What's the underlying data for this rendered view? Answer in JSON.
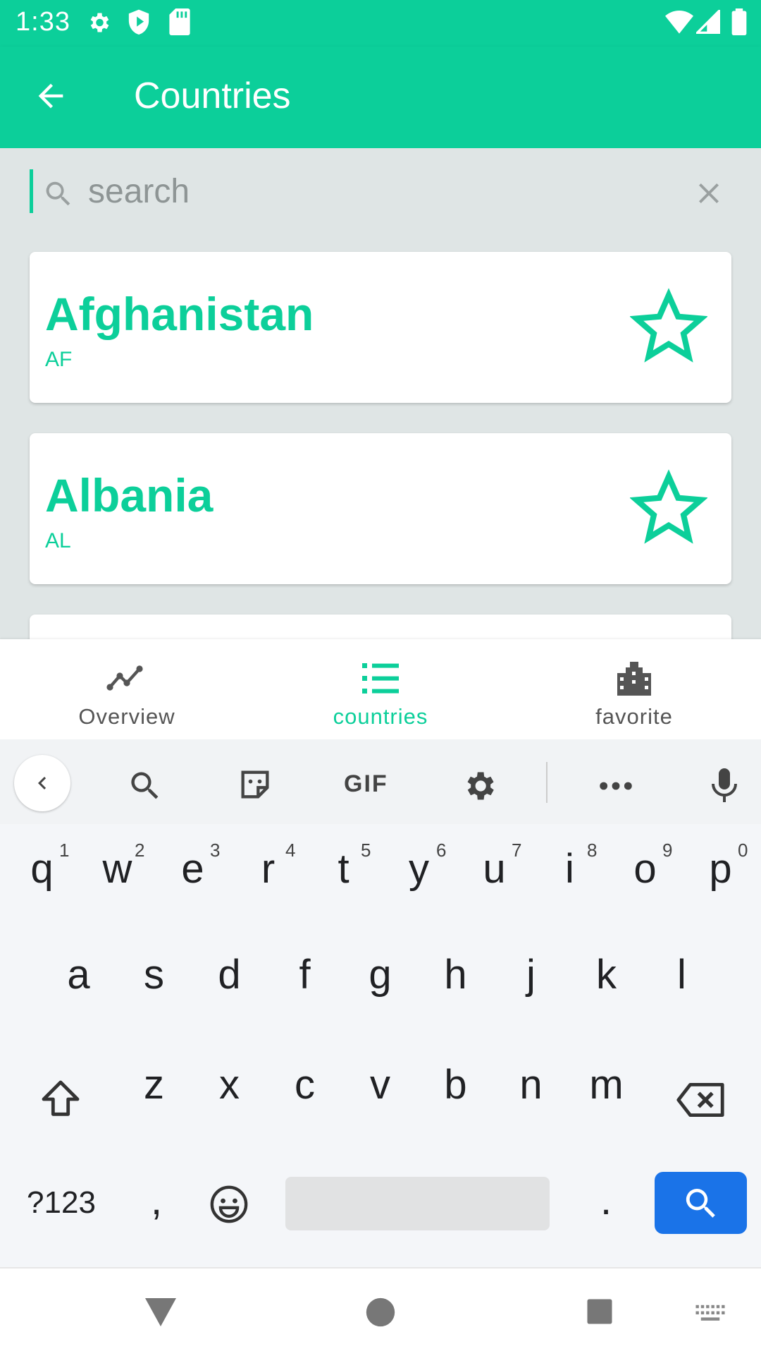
{
  "status_bar": {
    "time": "1:33"
  },
  "app_bar": {
    "title": "Countries"
  },
  "search": {
    "placeholder": "search",
    "value": ""
  },
  "countries": [
    {
      "name": "Afghanistan",
      "code": "AF",
      "favorite": false
    },
    {
      "name": "Albania",
      "code": "AL",
      "favorite": false
    }
  ],
  "bottom_nav": {
    "items": [
      {
        "label": "Overview",
        "active": false
      },
      {
        "label": "countries",
        "active": true
      },
      {
        "label": "favorite",
        "active": false
      }
    ]
  },
  "keyboard": {
    "toolbar": {
      "gif_label": "GIF"
    },
    "row1": [
      "q",
      "w",
      "e",
      "r",
      "t",
      "y",
      "u",
      "i",
      "o",
      "p"
    ],
    "row1_hints": [
      "1",
      "2",
      "3",
      "4",
      "5",
      "6",
      "7",
      "8",
      "9",
      "0"
    ],
    "row2": [
      "a",
      "s",
      "d",
      "f",
      "g",
      "h",
      "j",
      "k",
      "l"
    ],
    "row3": [
      "z",
      "x",
      "c",
      "v",
      "b",
      "n",
      "m"
    ],
    "symbols_label": "?123",
    "comma": ",",
    "period": "."
  },
  "colors": {
    "accent": "#0ccf9a",
    "search_key": "#1a73e8",
    "inactive": "#555555"
  }
}
